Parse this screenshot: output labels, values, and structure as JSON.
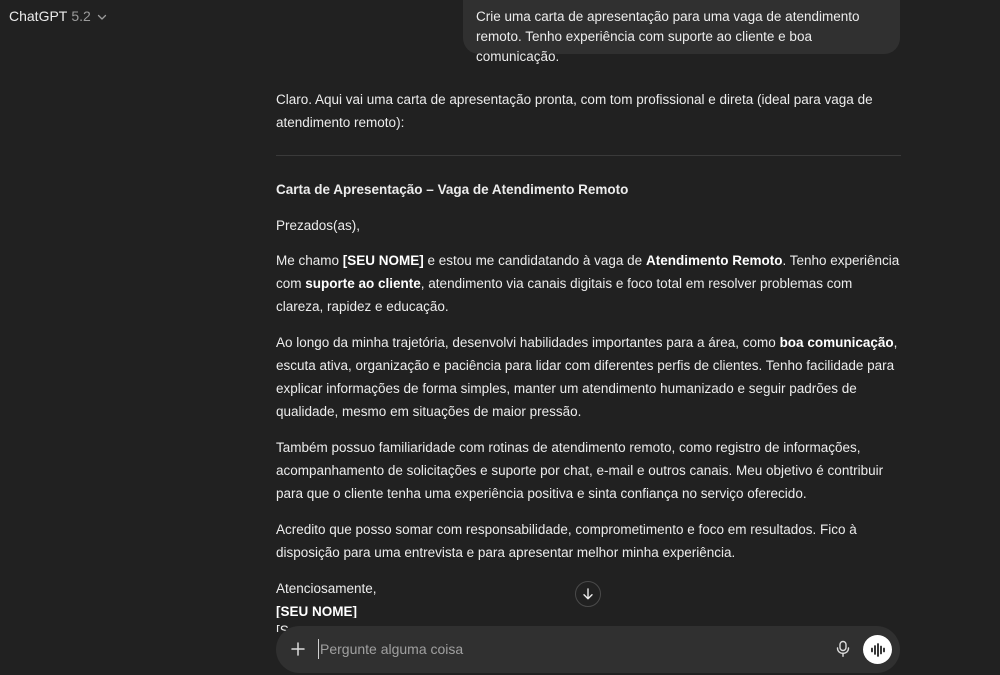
{
  "header": {
    "model_name": "ChatGPT",
    "model_version": "5.2",
    "chevron_icon": "chevron-down-icon"
  },
  "user_message": {
    "line1": "Crie uma carta de apresentação para uma vaga de atendimento",
    "line2": "remoto. Tenho experiência com suporte ao cliente e boa comunicação."
  },
  "assistant_message": {
    "intro": "Claro. Aqui vai uma carta de apresentação pronta, com tom profissional e direta (ideal para vaga de atendimento remoto):",
    "letter_title": "Carta de Apresentação – Vaga de Atendimento Remoto",
    "greeting": "Prezados(as),",
    "p1": {
      "t1": "Me chamo ",
      "b1": "[SEU NOME]",
      "t2": " e estou me candidatando à vaga de ",
      "b2": "Atendimento Remoto",
      "t3": ". Tenho experiência com ",
      "b3": "suporte ao cliente",
      "t4": ", atendimento via canais digitais e foco total em resolver problemas com clareza, rapidez e educação."
    },
    "p2": {
      "t1": "Ao longo da minha trajetória, desenvolvi habilidades importantes para a área, como ",
      "b1": "boa comunicação",
      "t2": ", escuta ativa, organização e paciência para lidar com diferentes perfis de clientes. Tenho facilidade para explicar informações de forma simples, manter um atendimento humanizado e seguir padrões de qualidade, mesmo em situações de maior pressão."
    },
    "p3": "Também possuo familiaridade com rotinas de atendimento remoto, como registro de informações, acompanhamento de solicitações e suporte por chat, e-mail e outros canais. Meu objetivo é contribuir para que o cliente tenha uma experiência positiva e sinta confiança no serviço oferecido.",
    "p4": "Acredito que posso somar com responsabilidade, comprometimento e foco em resultados. Fico à disposição para uma entrevista e para apresentar melhor minha experiência.",
    "closing": "Atenciosamente,",
    "signature": "[SEU NOME]",
    "clipped_next_line": "[S"
  },
  "scroll_button": {
    "icon": "arrow-down-icon"
  },
  "composer": {
    "placeholder": "Pergunte alguma coisa",
    "value": "",
    "plus_icon": "plus-icon",
    "mic_icon": "microphone-icon",
    "voice_icon": "voice-waveform-icon"
  },
  "colors": {
    "background": "#212121",
    "bubble": "#303030",
    "text": "#ececec",
    "muted": "#9b9b9b",
    "voice_button": "#ffffff"
  }
}
